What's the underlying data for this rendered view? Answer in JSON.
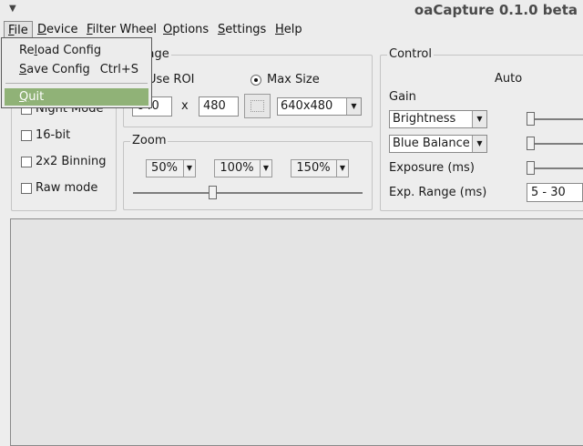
{
  "window": {
    "title": "oaCapture 0.1.0 beta",
    "menu_icon": "chevron-down-icon"
  },
  "menubar": {
    "items": [
      {
        "pre": "",
        "u": "F",
        "post": "ile"
      },
      {
        "pre": "",
        "u": "D",
        "post": "evice"
      },
      {
        "pre": "",
        "u": "F",
        "post": "ilter Wheel"
      },
      {
        "pre": "",
        "u": "O",
        "post": "ptions"
      },
      {
        "pre": "",
        "u": "S",
        "post": "ettings"
      },
      {
        "pre": "",
        "u": "H",
        "post": "elp"
      }
    ]
  },
  "file_menu": {
    "reload": {
      "pre": "Re",
      "u": "l",
      "post": "oad Config"
    },
    "save": {
      "pre": "",
      "u": "S",
      "post": "ave Config",
      "shortcut": "Ctrl+S"
    },
    "quit": {
      "pre": "",
      "u": "Q",
      "post": "uit"
    }
  },
  "camera_group": {
    "night_mode": "Night Mode",
    "bit16": "16-bit",
    "binning": "2x2 Binning",
    "raw_mode": "Raw mode"
  },
  "image_group": {
    "title": "Image",
    "use_roi": "Use ROI",
    "max_size": "Max Size",
    "width_value": "640",
    "x_label": "x",
    "height_value": "480",
    "resolution": "640x480"
  },
  "zoom_group": {
    "title": "Zoom",
    "buttons": [
      "50%",
      "100%",
      "150%"
    ],
    "slider_value": 0.35
  },
  "control_group": {
    "title": "Control",
    "auto_header": "Auto",
    "gain_label": "Gain",
    "combo1": "Brightness",
    "combo2": "Blue Balance",
    "exposure_label": "Exposure (ms)",
    "exp_range_label": "Exp. Range (ms)",
    "exp_range_value": "5 - 30"
  }
}
